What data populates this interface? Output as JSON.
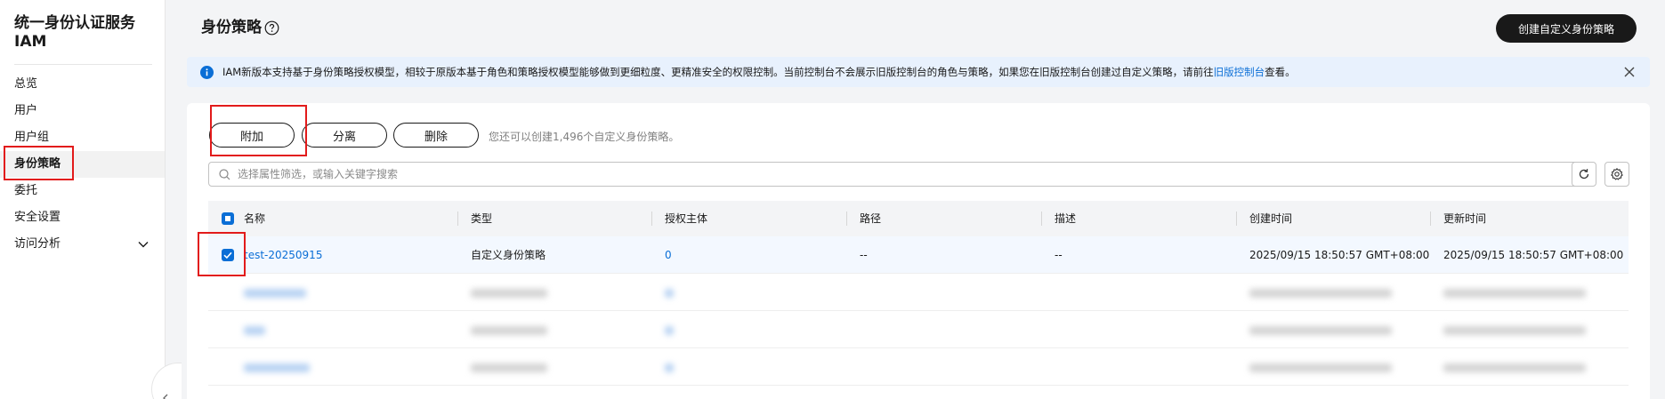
{
  "sidebar": {
    "title": "统一身份认证服务 IAM",
    "items": [
      {
        "label": "总览"
      },
      {
        "label": "用户"
      },
      {
        "label": "用户组"
      },
      {
        "label": "身份策略"
      },
      {
        "label": "委托"
      },
      {
        "label": "安全设置"
      },
      {
        "label": "访问分析"
      }
    ]
  },
  "header": {
    "title": "身份策略",
    "create_button": "创建自定义身份策略"
  },
  "notice": {
    "text": "IAM新版本支持基于身份策略授权模型，相较于原版本基于角色和策略授权模型能够做到更细粒度、更精准安全的权限控制。当前控制台不会展示旧版控制台的角色与策略，如果您在旧版控制台创建过自定义策略，请前往",
    "link_text": "旧版控制台",
    "suffix": "查看。"
  },
  "toolbar": {
    "attach_label": "附加",
    "detach_label": "分离",
    "delete_label": "删除",
    "hint": "您还可以创建1,496个自定义身份策略。"
  },
  "search": {
    "placeholder": "选择属性筛选，或输入关键字搜索"
  },
  "table": {
    "columns": [
      "名称",
      "类型",
      "授权主体",
      "路径",
      "描述",
      "创建时间",
      "更新时间"
    ],
    "rows": [
      {
        "name": "test-20250915",
        "type": "自定义身份策略",
        "principals": "0",
        "path": "--",
        "description": "--",
        "created": "2025/09/15 18:50:57 GMT+08:00",
        "updated": "2025/09/15 18:50:57 GMT+08:00",
        "selected": true
      }
    ]
  },
  "colors": {
    "accent": "#0a6ed6",
    "highlight": "#e21b1b",
    "dark_button": "#191919",
    "info_background": "#e8f1fd"
  }
}
